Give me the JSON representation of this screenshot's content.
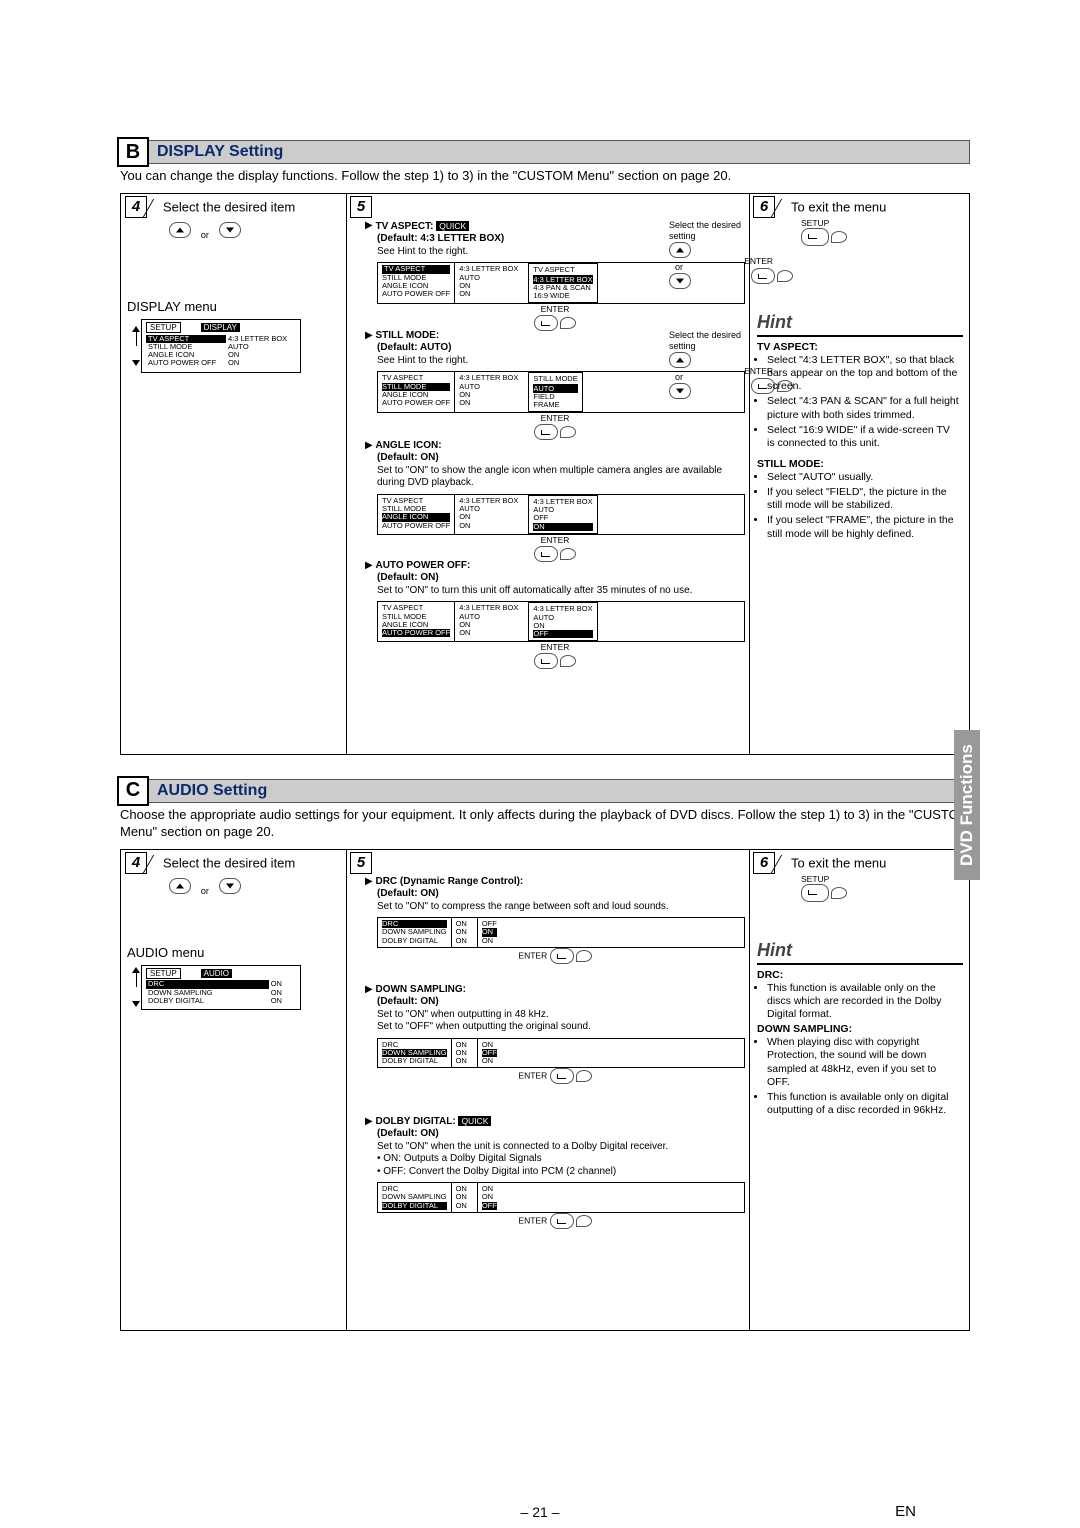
{
  "sectionB": {
    "letter": "B",
    "title": "DISPLAY Setting",
    "intro": "You can change the display functions. Follow the step 1) to 3) in the \"CUSTOM Menu\" section on page 20.",
    "step4": "Select the desired item",
    "step4num": "4",
    "or": "or",
    "menu_label": "DISPLAY menu",
    "menu": {
      "setup": "SETUP",
      "display": "DISPLAY",
      "r1a": "TV ASPECT",
      "r1b": "4:3 LETTER BOX",
      "r2a": "STILL MODE",
      "r2b": "AUTO",
      "r3a": "ANGLE ICON",
      "r3b": "ON",
      "r4a": "AUTO POWER OFF",
      "r4b": "ON"
    },
    "step5num": "5",
    "tv_aspect": {
      "lbl": "TV ASPECT:",
      "quick": "QUICK",
      "def": "(Default: 4:3 LETTER BOX)",
      "see": "See Hint to the right.",
      "opt_head": "TV ASPECT",
      "o1": "4:3 LETTER BOX",
      "o2": "4:3 PAN & SCAN",
      "o3": "16:9 WIDE",
      "side": "Select the desired setting",
      "enter": "ENTER"
    },
    "still_mode": {
      "lbl": "STILL MODE:",
      "def": "(Default: AUTO)",
      "see": "See Hint to the right.",
      "opt_head": "STILL MODE",
      "o1": "AUTO",
      "o2": "FIELD",
      "o3": "FRAME",
      "side": "Select the desired setting",
      "enter": "ENTER"
    },
    "angle_icon": {
      "lbl": "ANGLE ICON:",
      "def": "(Default: ON)",
      "desc": "Set to \"ON\" to show the angle icon when multiple camera angles are available during DVD playback.",
      "o_head": "4:3 LETTER BOX",
      "o1": "AUTO",
      "o2": "OFF",
      "o3": "ON",
      "enter": "ENTER"
    },
    "auto_power": {
      "lbl": "AUTO POWER OFF:",
      "def": "(Default: ON)",
      "desc": "Set to \"ON\" to turn this unit off automatically after 35 minutes of no use.",
      "o_head": "4:3 LETTER BOX",
      "o1": "AUTO",
      "o2": "ON",
      "o3": "OFF",
      "enter": "ENTER"
    },
    "step6num": "6",
    "step6": "To exit the menu",
    "setup_btn": "SETUP",
    "hint": "Hint",
    "hint_tv_head": "TV ASPECT:",
    "hint_tv_1": "Select \"4:3 LETTER BOX\", so that black bars appear on the top and bottom of the screen.",
    "hint_tv_2": "Select \"4:3 PAN & SCAN\" for a full height picture with both sides trimmed.",
    "hint_tv_3": "Select \"16:9 WIDE\" if a wide-screen TV is connected to this unit.",
    "hint_still_head": "STILL MODE:",
    "hint_still_1": "Select \"AUTO\" usually.",
    "hint_still_2": "If you select \"FIELD\", the picture in the still mode will be stabilized.",
    "hint_still_3": "If you select \"FRAME\", the picture in the still mode will be highly defined."
  },
  "sectionC": {
    "letter": "C",
    "title": "AUDIO Setting",
    "intro": "Choose the appropriate audio settings for your equipment. It only affects during the playback of DVD discs. Follow the step 1) to 3) in the \"CUSTOM Menu\" section on page 20.",
    "step4num": "4",
    "step4": "Select the desired item",
    "or": "or",
    "menu_label": "AUDIO menu",
    "menu": {
      "setup": "SETUP",
      "audio": "AUDIO",
      "r1a": "DRC",
      "r1b": "ON",
      "r2a": "DOWN SAMPLING",
      "r2b": "ON",
      "r3a": "DOLBY DIGITAL",
      "r3b": "ON"
    },
    "step5num": "5",
    "drc": {
      "lbl": "DRC (Dynamic Range Control):",
      "def": "(Default: ON)",
      "desc": "Set to \"ON\" to compress the range between soft and loud sounds.",
      "o1": "OFF",
      "o2": "ON",
      "o3": "ON",
      "enter": "ENTER"
    },
    "down": {
      "lbl": "DOWN SAMPLING:",
      "def": "(Default: ON)",
      "d1": "Set to \"ON\" when outputting in 48 kHz.",
      "d2": "Set to \"OFF\" when outputting the original sound.",
      "o1": "ON",
      "o2": "OFF",
      "o3": "ON",
      "enter": "ENTER"
    },
    "dolby": {
      "lbl": "DOLBY DIGITAL:",
      "quick": "QUICK",
      "def": "(Default: ON)",
      "d1": "Set to \"ON\" when the unit is connected to a Dolby Digital receiver.",
      "d2": "ON: Outputs a Dolby Digital Signals",
      "d3": "OFF: Convert the Dolby Digital into PCM (2 channel)",
      "o1": "ON",
      "o2": "ON",
      "o3": "OFF",
      "enter": "ENTER"
    },
    "step6num": "6",
    "step6": "To exit the menu",
    "setup_btn": "SETUP",
    "hint": "Hint",
    "hint_drc_head": "DRC:",
    "hint_drc_1": "This function is available only on the discs which are recorded in the Dolby Digital format.",
    "hint_ds_head": "DOWN SAMPLING:",
    "hint_ds_1": "When playing disc with copyright Protection, the sound will be down sampled at 48kHz, even if you set to OFF.",
    "hint_ds_2": "This function is available only on digital outputting of a disc recorded in 96kHz."
  },
  "footer": {
    "page": "– 21 –",
    "lang": "EN"
  },
  "side_tab": "DVD Functions"
}
